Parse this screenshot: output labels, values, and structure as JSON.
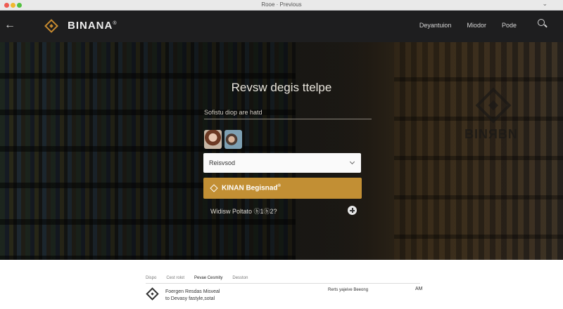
{
  "window": {
    "title": "Rooe · Previous",
    "extra": "⌄"
  },
  "nav": {
    "brand": "BINANA",
    "brand_mark": "®",
    "links": [
      "Deyantuion",
      "Miodor",
      "Pode"
    ]
  },
  "hero": {
    "title": "Revsw degis ttelpe",
    "subtitle": "Sofistu diop are hatd",
    "select_value": "Reisvsod",
    "cta_label": "KINAN Begisnad",
    "cta_mark": "®",
    "more_text": "Widisw Poltato ⓑ1ⓑ2?",
    "watermark_text": "BINЯBN"
  },
  "footer": {
    "tabs": [
      "Dispo",
      "Cest rolot",
      "Pevae Cesmity",
      "Desston"
    ],
    "description": [
      "Foergen Resdas Misveal",
      "to Devasy fastyle,sotal"
    ],
    "middle_text": "Rerts yajeive Beeong",
    "right_text": "AM"
  },
  "colors": {
    "accent": "#c28f34",
    "nav_bg": "#1e1e1f"
  }
}
